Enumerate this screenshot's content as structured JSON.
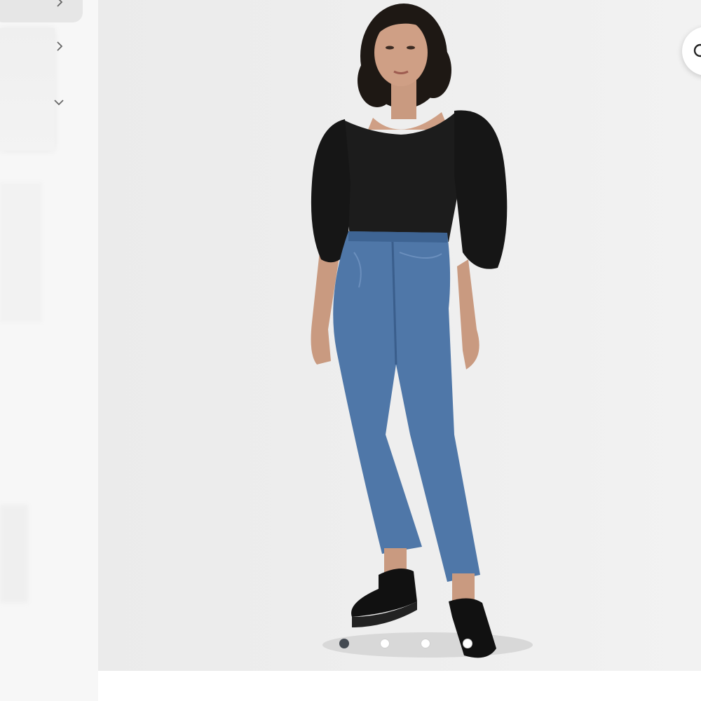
{
  "gallery": {
    "image_description": "Product photo",
    "slide_count": 4,
    "active_slide": 1
  },
  "sidebar": {
    "controls": [
      "chevron-right-icon",
      "chevron-right-icon",
      "chevron-down-icon"
    ]
  },
  "colors": {
    "background": "#eeeeee",
    "dot_active": "#444a52",
    "dot_inactive": "#ffffff"
  }
}
